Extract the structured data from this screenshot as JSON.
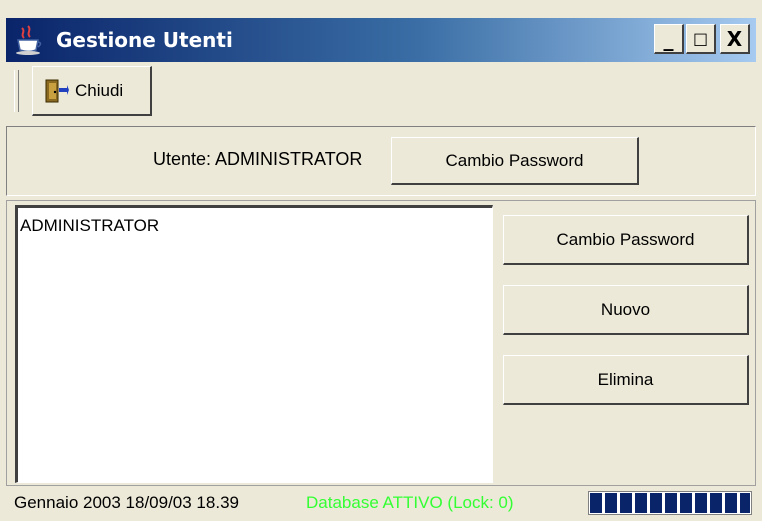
{
  "window": {
    "title": "Gestione Utenti",
    "minimize_label": "_",
    "maximize_label": "□",
    "close_label": "X"
  },
  "toolbar": {
    "close_label": "Chiudi"
  },
  "user_panel": {
    "label": "Utente: ADMINISTRATOR",
    "change_password_label": "Cambio Password"
  },
  "users": {
    "items": [
      "ADMINISTRATOR"
    ]
  },
  "actions": {
    "change_password_label": "Cambio Password",
    "new_label": "Nuovo",
    "delete_label": "Elimina"
  },
  "status": {
    "date_text": "Gennaio 2003 18/09/03 18.39",
    "db_text": "Database ATTIVO (Lock: 0)",
    "db_color": "#33ff33",
    "progress_fraction": 1.0
  },
  "icons": {
    "app": "java-cup-icon",
    "close": "door-exit-icon"
  },
  "colors": {
    "titlebar_start": "#0a246a",
    "titlebar_end": "#a6caf0",
    "face": "#ece9d8"
  }
}
